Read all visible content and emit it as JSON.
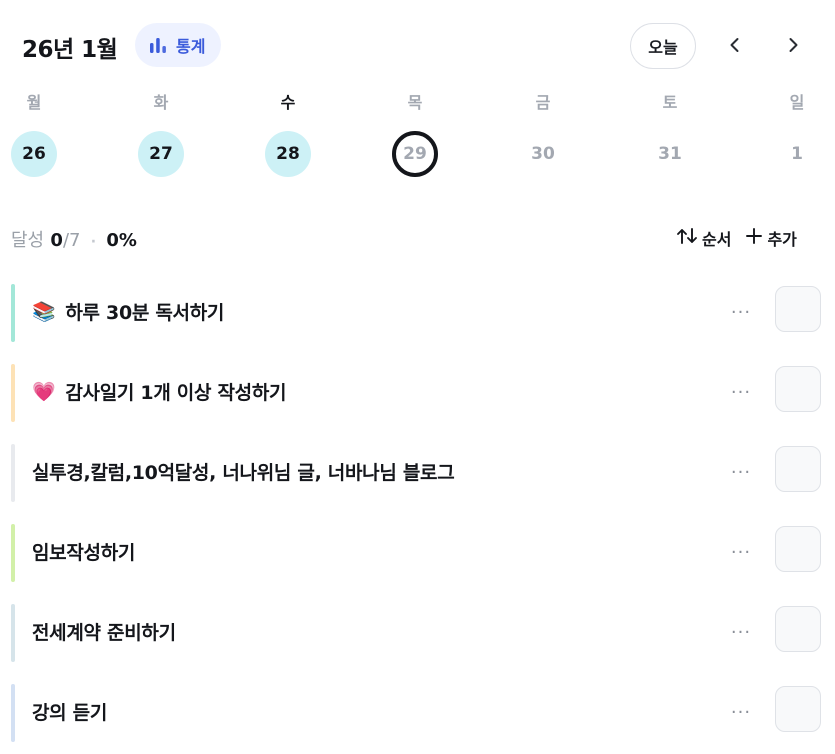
{
  "header": {
    "month_title": "26년 1월",
    "stats_label": "통계",
    "today_label": "오늘",
    "prev_icon": "chevron-left-icon",
    "next_icon": "chevron-right-icon"
  },
  "week": [
    {
      "dow": "월",
      "date": "26",
      "state": "done"
    },
    {
      "dow": "화",
      "date": "27",
      "state": "done"
    },
    {
      "dow": "수",
      "date": "28",
      "state": "done",
      "active": true
    },
    {
      "dow": "목",
      "date": "29",
      "state": "today"
    },
    {
      "dow": "금",
      "date": "30",
      "state": "future"
    },
    {
      "dow": "토",
      "date": "31",
      "state": "future"
    },
    {
      "dow": "일",
      "date": "1",
      "state": "future"
    }
  ],
  "summary": {
    "label": "달성",
    "done": "0",
    "total": "/7",
    "separator": "·",
    "percent": "0%"
  },
  "actions": {
    "sort_label": "순서",
    "add_label": "추가"
  },
  "colors": {
    "accent": "#3b5bdb",
    "done_circle": "#cdf1f6",
    "text": "#14161b",
    "muted": "#a3a8b1"
  },
  "tasks": [
    {
      "emoji": "📚",
      "title": "하루 30분 독서하기",
      "bar_color": "#a3e7d8"
    },
    {
      "emoji": "💗",
      "title": "감사일기 1개 이상 작성하기",
      "bar_color": "#fde2b6"
    },
    {
      "emoji": "",
      "title": "실투경,칼럼,10억달성, 너나위님 글, 너바나님 블로그",
      "bar_color": "#e8eaee"
    },
    {
      "emoji": "",
      "title": "임보작성하기",
      "bar_color": "#d2f0a9"
    },
    {
      "emoji": "",
      "title": "전세계약 준비하기",
      "bar_color": "#d6e4ea"
    },
    {
      "emoji": "",
      "title": "강의 듣기",
      "bar_color": "#d3e0f3"
    }
  ],
  "task_more_label": "···"
}
